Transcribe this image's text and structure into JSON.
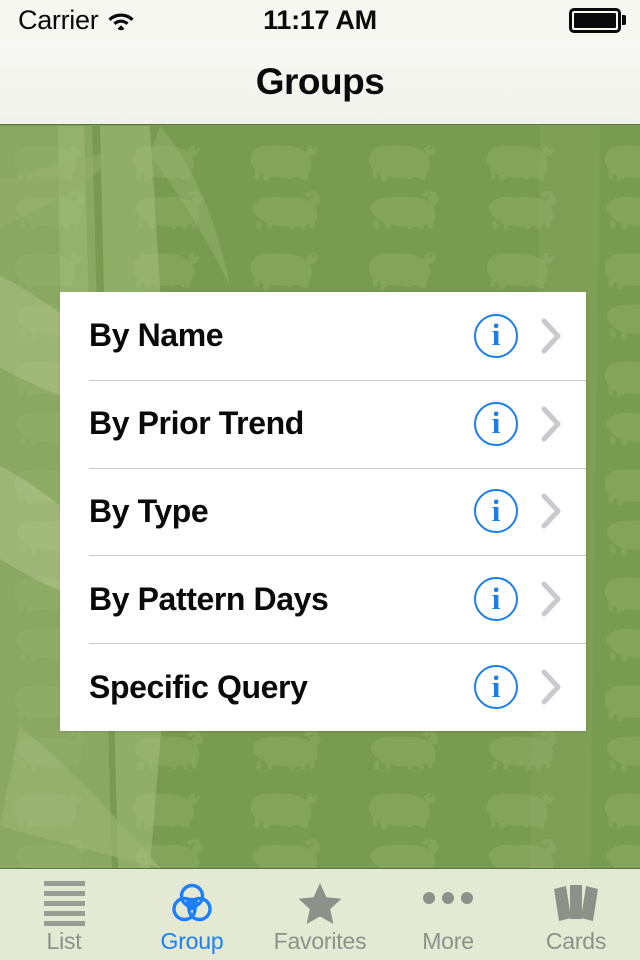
{
  "status_bar": {
    "carrier": "Carrier",
    "wifi_icon": "wifi-icon",
    "time": "11:17 AM",
    "battery_icon": "battery-full-icon"
  },
  "nav_bar": {
    "title": "Groups"
  },
  "wallpaper": {
    "description": "bear-and-bull-pattern-with-bamboo",
    "base_color": "#7b9c52",
    "animal_color": "#89a85f",
    "bamboo_color": "#a8bd7e"
  },
  "group_list": {
    "rows": [
      {
        "label": "By Name",
        "info_icon": "info-circle-icon",
        "chevron": "chevron-right-icon"
      },
      {
        "label": "By Prior Trend",
        "info_icon": "info-circle-icon",
        "chevron": "chevron-right-icon"
      },
      {
        "label": "By Type",
        "info_icon": "info-circle-icon",
        "chevron": "chevron-right-icon"
      },
      {
        "label": "By Pattern Days",
        "info_icon": "info-circle-icon",
        "chevron": "chevron-right-icon"
      },
      {
        "label": "Specific Query",
        "info_icon": "info-circle-icon",
        "chevron": "chevron-right-icon"
      }
    ],
    "info_glyph": "i",
    "accent_color": "#1a7ee8",
    "chevron_color": "#c9c9ce"
  },
  "tab_bar": {
    "selected_index": 1,
    "selected_color": "#1d7ffb",
    "inactive_color": "#8e9189",
    "items": [
      {
        "label": "List",
        "icon": "list-lines-icon"
      },
      {
        "label": "Group",
        "icon": "venn-circles-icon"
      },
      {
        "label": "Favorites",
        "icon": "star-icon"
      },
      {
        "label": "More",
        "icon": "ellipsis-icon"
      },
      {
        "label": "Cards",
        "icon": "cards-deck-icon"
      }
    ]
  }
}
